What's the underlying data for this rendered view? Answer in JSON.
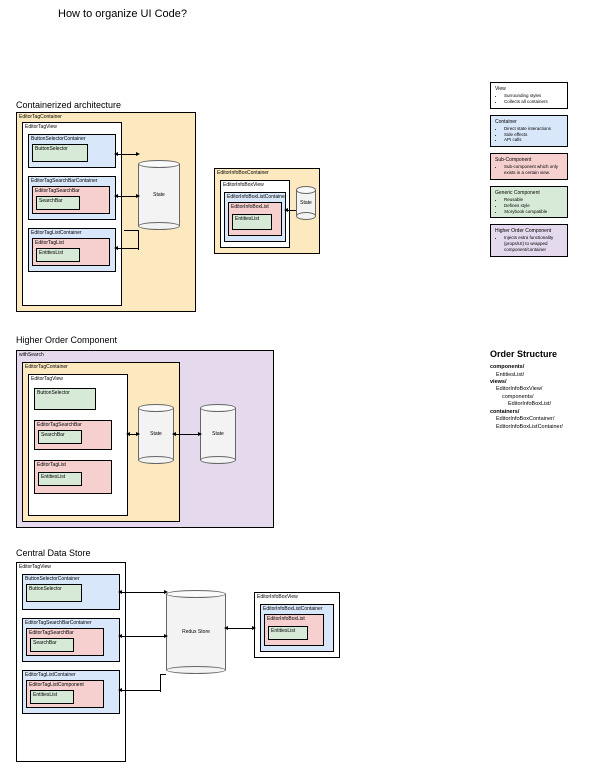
{
  "title": "How to organize UI Code?",
  "sections": {
    "containerized": "Containerized architecture",
    "hoc": "Higher Order Component",
    "cds": "Central Data Store"
  },
  "colors": {
    "view": "#ffffff",
    "container": "#d9e7fb",
    "subcomponent": "#f6cfcf",
    "generic": "#d7ead8",
    "hoc": "#e5d9ee",
    "wrapper_yellow": "#fce9c0"
  },
  "legend": [
    {
      "name": "View",
      "color": "view",
      "bullets": [
        "Surrounding styles",
        "Collects all containers"
      ]
    },
    {
      "name": "Container",
      "color": "container",
      "bullets": [
        "Direct state interactions",
        "Side effects",
        "API calls"
      ]
    },
    {
      "name": "Sub-Component",
      "color": "subcomponent",
      "bullets": [
        "Sub-component which only exists in a certain view."
      ]
    },
    {
      "name": "Generic Component",
      "color": "generic",
      "bullets": [
        "Reusable",
        "Defines style",
        "Storybook compatible"
      ]
    },
    {
      "name": "Higher Order Component",
      "color": "hoc",
      "bullets": [
        "Injects extra functionality (props/UI) to wrapped component/container"
      ]
    }
  ],
  "boxes": {
    "etc": "EditorTagContainer",
    "etv": "EditorTagView",
    "bsc": "ButtonSelectorContainer",
    "bs": "ButtonSelector",
    "etsbc": "EditorTagSearchBarContainer",
    "etsb": "EditorTagSearchBar",
    "sb": "SearchBar",
    "etlc": "EditorTagListContainer",
    "etl": "EditorTagList",
    "etlcmp": "EditorTagListComponent",
    "el": "EntitiesList",
    "eibc": "EditorInfoBoxContainer",
    "eibv": "EditorInfoBoxView",
    "eiblc": "EditorInfoBoxListContainer",
    "eibl": "EditorInfoBoxList",
    "ws": "withSearch",
    "state": "State",
    "redux": "Redux Store"
  },
  "order_structure": {
    "heading": "Order Structure",
    "lines": [
      {
        "t": "components/",
        "cls": "b"
      },
      {
        "t": "EntitiesList/",
        "cls": "i1"
      },
      {
        "t": "views/",
        "cls": "b"
      },
      {
        "t": "EditorInfoBoxView/",
        "cls": "i1"
      },
      {
        "t": "components/",
        "cls": "i2"
      },
      {
        "t": "EditorInfoBoxList/",
        "cls": "i3"
      },
      {
        "t": "containers/",
        "cls": "b"
      },
      {
        "t": "EditorInfoBoxContainer/",
        "cls": "i1"
      },
      {
        "t": "EditorInfoBoxListContainer/",
        "cls": "i1"
      }
    ]
  }
}
